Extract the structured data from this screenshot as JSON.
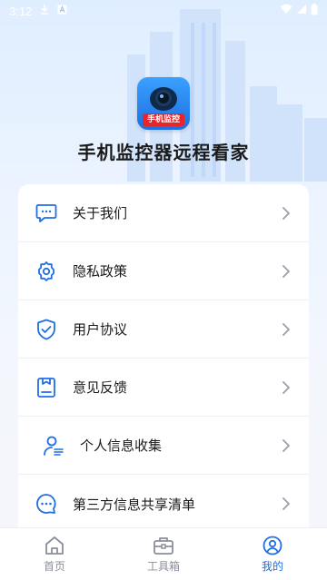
{
  "status_bar": {
    "time": "3:12"
  },
  "app": {
    "logo_text": "手机监控",
    "title": "手机监控器远程看家"
  },
  "menu": {
    "items": [
      {
        "label": "关于我们",
        "icon": "chat-info-icon"
      },
      {
        "label": "隐私政策",
        "icon": "gear-icon"
      },
      {
        "label": "用户协议",
        "icon": "shield-check-icon"
      },
      {
        "label": "意见反馈",
        "icon": "feedback-icon"
      },
      {
        "label": "个人信息收集",
        "icon": "user-info-icon"
      },
      {
        "label": "第三方信息共享清单",
        "icon": "message-dots-icon"
      }
    ]
  },
  "bottom_nav": {
    "items": [
      {
        "label": "首页",
        "icon": "home-icon"
      },
      {
        "label": "工具箱",
        "icon": "toolbox-icon"
      },
      {
        "label": "我的",
        "icon": "profile-icon"
      }
    ],
    "active_index": 2
  },
  "colors": {
    "accent": "#1f6fe5",
    "inactive": "#8a8f99"
  }
}
